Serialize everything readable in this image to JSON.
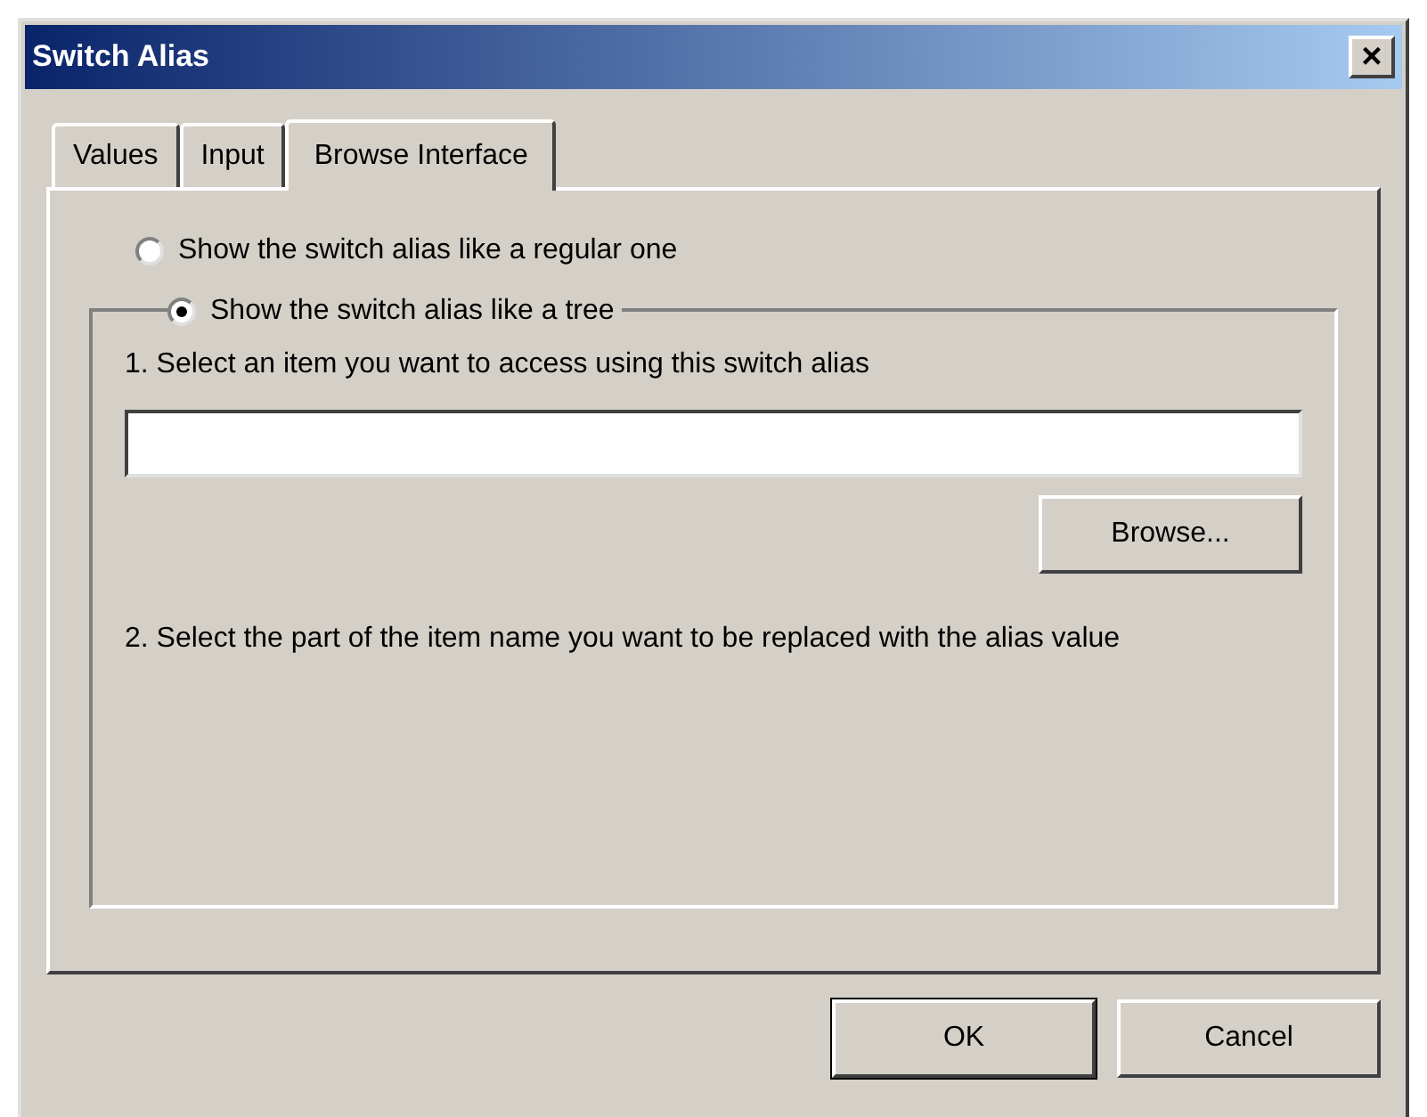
{
  "window": {
    "title": "Switch Alias",
    "close": "×"
  },
  "tabs": [
    {
      "label": "Values",
      "selected": false
    },
    {
      "label": "Input",
      "selected": false
    },
    {
      "label": "Browse Interface",
      "selected": true
    }
  ],
  "options": [
    {
      "label": "Show the switch alias like a regular one",
      "selected": false
    },
    {
      "label": "Show the switch alias like a tree",
      "selected": true
    }
  ],
  "group": {
    "step1": "1. Select an item you want to access using this switch alias",
    "browse_button": "Browse...",
    "step2": "2. Select the part of the item name you want to be replaced with the alias value"
  },
  "buttons": [
    {
      "label": "OK",
      "default": true
    },
    {
      "label": "Cancel",
      "default": false
    }
  ]
}
